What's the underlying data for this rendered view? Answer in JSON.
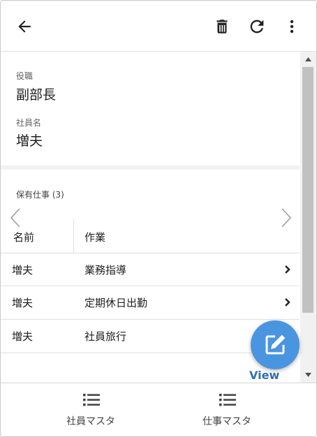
{
  "toolbar": {
    "back_icon": "arrow-left-icon",
    "delete_icon": "trash-icon",
    "refresh_icon": "refresh-icon",
    "more_icon": "more-vertical-icon"
  },
  "record": {
    "position_label": "役職",
    "position_value": "副部長",
    "employee_label": "社員名",
    "employee_value": "増夫"
  },
  "jobs": {
    "title": "保有仕事 (3)",
    "columns": [
      "名前",
      "作業"
    ],
    "rows": [
      {
        "name": "増夫",
        "task": "業務指導",
        "has_chevron": true
      },
      {
        "name": "増夫",
        "task": "定期休日出勤",
        "has_chevron": true
      },
      {
        "name": "増夫",
        "task": "社員旅行",
        "has_chevron": false
      }
    ]
  },
  "fab": {
    "label": "View",
    "icon": "edit-icon",
    "color": "#4a95e0"
  },
  "bottom_nav": [
    {
      "label": "社員マスタ",
      "icon": "list-icon"
    },
    {
      "label": "仕事マスタ",
      "icon": "list-icon"
    }
  ]
}
